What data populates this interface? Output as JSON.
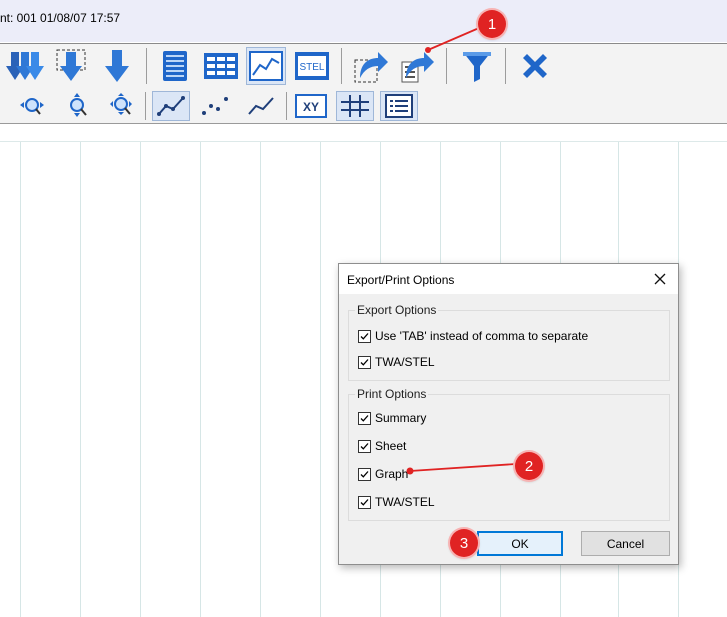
{
  "window": {
    "title_fragment": "nt: 001 01/08/07 17:57"
  },
  "toolbar_primary": [
    {
      "name": "download-all-icon"
    },
    {
      "name": "download-selection-icon"
    },
    {
      "name": "download-icon"
    },
    {
      "name": "summary-report-icon"
    },
    {
      "name": "sheet-view-icon"
    },
    {
      "name": "graph-view-icon"
    },
    {
      "name": "stel-view-icon",
      "text": "STEL"
    },
    {
      "name": "export-selection-icon"
    },
    {
      "name": "export-print-icon"
    },
    {
      "name": "filter-icon"
    },
    {
      "name": "delete-icon"
    }
  ],
  "toolbar_secondary": [
    {
      "name": "zoom-horizontal-icon"
    },
    {
      "name": "zoom-vertical-icon"
    },
    {
      "name": "zoom-all-icon"
    },
    {
      "name": "line-points-icon"
    },
    {
      "name": "points-icon"
    },
    {
      "name": "line-icon"
    },
    {
      "name": "xy-axis-icon",
      "text": "XY"
    },
    {
      "name": "grid-icon"
    },
    {
      "name": "list-icon"
    }
  ],
  "dialog": {
    "title": "Export/Print Options",
    "export_group": "Export Options",
    "export_items": [
      {
        "label": "Use 'TAB' instead of comma to separate",
        "checked": true
      },
      {
        "label": "TWA/STEL",
        "checked": true
      }
    ],
    "print_group": "Print Options",
    "print_items": [
      {
        "label": "Summary",
        "checked": true
      },
      {
        "label": "Sheet",
        "checked": true
      },
      {
        "label": "Graph",
        "checked": true
      },
      {
        "label": "TWA/STEL",
        "checked": true
      }
    ],
    "ok_label": "OK",
    "cancel_label": "Cancel"
  },
  "annotations": {
    "marker1": "1",
    "marker2": "2",
    "marker3": "3"
  },
  "colors": {
    "marker": "#e02323",
    "toolbar_icon_blue": "#1b6fd1",
    "dialog_bg": "#f0f0f0",
    "default_button_border": "#0078d7"
  }
}
